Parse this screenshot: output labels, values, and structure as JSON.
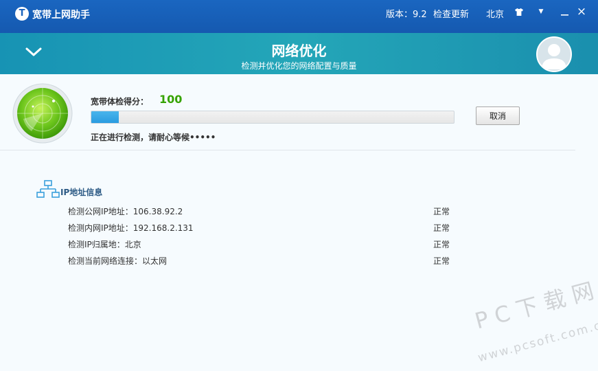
{
  "app": {
    "logo_glyph": "T",
    "title": "宽带上网助手",
    "version": "版本：9.2",
    "check_update": "检查更新",
    "city": "北京"
  },
  "window_controls": {
    "skin_icon": "tshirt-icon",
    "menu_icon": "menu-down-icon",
    "minimize_icon": "minimize-icon",
    "close_icon": "close-icon",
    "menu_glyph": "▼",
    "close_glyph": "×"
  },
  "banner": {
    "title": "网络优化",
    "subtitle": "检测并优化您的网络配置与质量"
  },
  "detection": {
    "score_label": "宽带体检得分：",
    "score_value": "100",
    "progress_fraction": 0.075,
    "status_text": "正在进行检测，请耐心等候•••••",
    "cancel_label": "取消"
  },
  "ip_info": {
    "section_title": "IP地址信息",
    "rows": [
      {
        "label": "检测公网IP地址：106.38.92.2",
        "status": "正常"
      },
      {
        "label": "检测内网IP地址：192.168.2.131",
        "status": "正常"
      },
      {
        "label": "检测IP归属地：北京",
        "status": "正常"
      },
      {
        "label": "检测当前网络连接：以太网",
        "status": "正常"
      }
    ]
  },
  "watermark": {
    "main": "PC下载网",
    "url": "www.pcsoft.com.cn"
  },
  "colors": {
    "titlebar": "#1a63bc",
    "banner": "#1f9cb6",
    "score": "#36a300",
    "progress": "#3aa8e8",
    "section_title": "#2c5a85"
  }
}
